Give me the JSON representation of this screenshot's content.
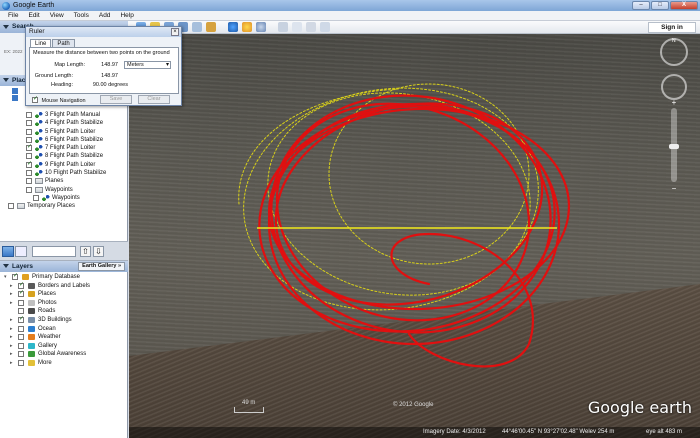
{
  "window": {
    "title": "Google Earth",
    "controls": {
      "minimize": "–",
      "maximize": "□",
      "close": "X"
    }
  },
  "menu": {
    "items": [
      "File",
      "Edit",
      "View",
      "Tools",
      "Add",
      "Help"
    ]
  },
  "toolbar": {
    "sign_in": "Sign in"
  },
  "panels": {
    "search": {
      "label": "Search",
      "hint": "EX: 2022"
    },
    "places": {
      "label": "Places"
    },
    "layers": {
      "label": "Layers",
      "gallery_button": "Earth Gallery »"
    }
  },
  "places_tree": [
    {
      "label": "3 Flight Path Manual",
      "checked": false,
      "type": "path"
    },
    {
      "label": "4 Flight Path Stabilize",
      "checked": false,
      "type": "path"
    },
    {
      "label": "5 Flight Path Loiter",
      "checked": false,
      "type": "path"
    },
    {
      "label": "6 Flight Path Stabilize",
      "checked": false,
      "type": "path"
    },
    {
      "label": "7 Flight Path Loiter",
      "checked": true,
      "type": "path"
    },
    {
      "label": "8 Flight Path Stabilize",
      "checked": false,
      "type": "path"
    },
    {
      "label": "9 Flight Path Loiter",
      "checked": true,
      "type": "path"
    },
    {
      "label": "10 Flight Path Stabilize",
      "checked": false,
      "type": "path"
    },
    {
      "label": "Planes",
      "checked": false,
      "type": "folder"
    },
    {
      "label": "Waypoints",
      "checked": false,
      "type": "folder"
    },
    {
      "label": "Waypoints",
      "checked": false,
      "type": "waypoint"
    },
    {
      "label": "Temporary Places",
      "checked": false,
      "type": "folder-root"
    }
  ],
  "layers_tree": [
    {
      "label": "Primary Database",
      "checked": true,
      "color": "#e0a020"
    },
    {
      "label": "Borders and Labels",
      "checked": true,
      "color": "#5a5a5a"
    },
    {
      "label": "Places",
      "checked": true,
      "color": "#d6a21f"
    },
    {
      "label": "Photos",
      "checked": false,
      "color": "#c0c0c0"
    },
    {
      "label": "Roads",
      "checked": false,
      "color": "#4a4a4a"
    },
    {
      "label": "3D Buildings",
      "checked": true,
      "color": "#7a8fa8"
    },
    {
      "label": "Ocean",
      "checked": false,
      "color": "#2c7fd0"
    },
    {
      "label": "Weather",
      "checked": false,
      "color": "#e57d1c"
    },
    {
      "label": "Gallery",
      "checked": false,
      "color": "#2db6c9"
    },
    {
      "label": "Global Awareness",
      "checked": false,
      "color": "#3a9a3a"
    },
    {
      "label": "More",
      "checked": false,
      "color": "#e2c038"
    }
  ],
  "ruler": {
    "title": "Ruler",
    "tabs": [
      "Line",
      "Path"
    ],
    "description": "Measure the distance between two points on the ground",
    "map_length_label": "Map Length:",
    "map_length_value": "148.97",
    "unit": "Meters",
    "ground_length_label": "Ground Length:",
    "ground_length_value": "148.97",
    "heading_label": "Heading:",
    "heading_value": "90.00 degrees",
    "mouse_navigation": "Mouse Navigation",
    "save": "Save",
    "clear": "Clear"
  },
  "map": {
    "scale_label": "49 m",
    "copyright": "© 2012 Google",
    "logo": "Google earth",
    "compass_label": "N",
    "zoom_in": "+",
    "zoom_out": "−",
    "zoom_level": 0.52,
    "status": {
      "imagery_date": "Imagery Date: 4/3/2012",
      "coords": "44°46'00.45\" N  93°27'02.48\" W",
      "elev": "elev  254 m",
      "eye_alt": "eye alt  483 m"
    },
    "colors": {
      "flight_path": "#e01010",
      "waypoint_path": "#d8d01a",
      "ruler_line": "#f2ea1c"
    }
  }
}
